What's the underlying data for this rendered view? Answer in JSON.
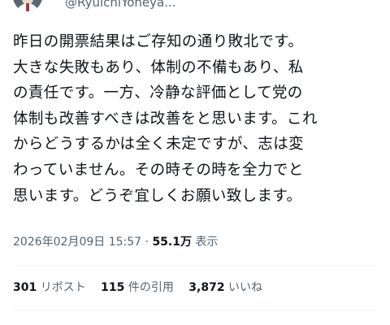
{
  "author": {
    "handle": "@RyuichiYoneya..."
  },
  "tweet": {
    "text": "昨日の開票結果はご存知の通り敗北です。\n大きな失敗もあり、体制の不備もあり、私\nの責任です。一方、冷静な評価として党の\n体制も改善すべきは改善をと思います。これ\nからどうするかは全く未定ですが、志は変\nわっていません。その時その時を全力でと\n思います。どうぞ宜しくお願い致します。",
    "date": "2026年02月09日",
    "time": "15:57",
    "separator": "·",
    "views": "55.1万",
    "views_label": "表示"
  },
  "stats": {
    "reposts_count": "301",
    "reposts_label": "リポスト",
    "quotes_count": "115",
    "quotes_label": "件の引用",
    "likes_count": "3,872",
    "likes_label": "いいね"
  }
}
